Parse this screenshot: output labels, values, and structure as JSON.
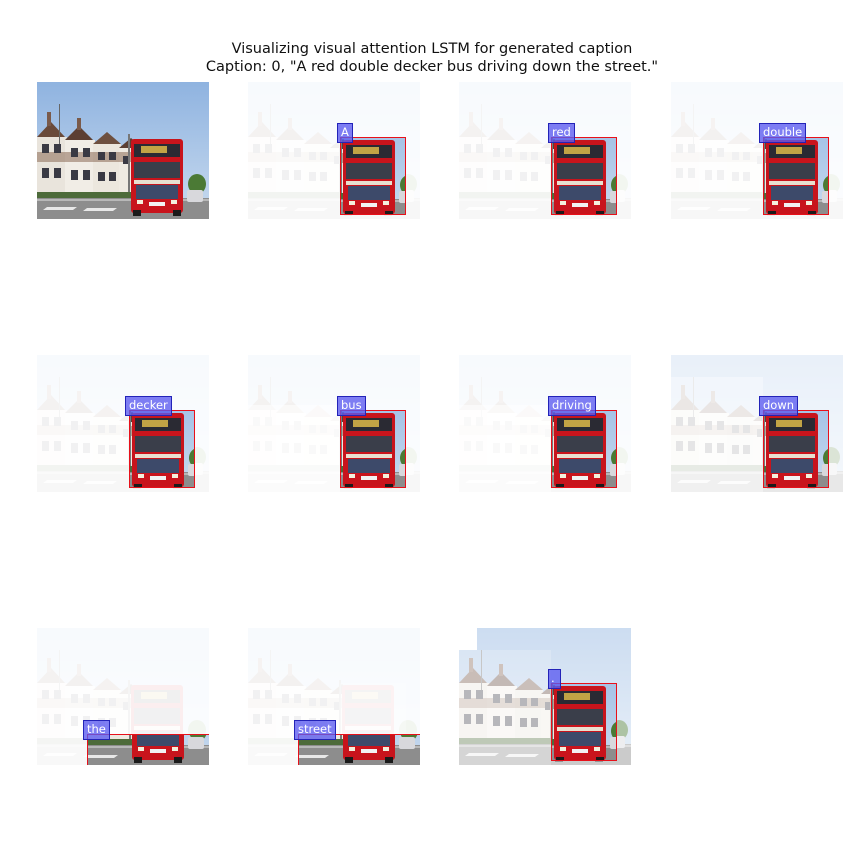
{
  "figure": {
    "title_line1": "Visualizing visual attention LSTM for generated caption",
    "title_line2": "Caption: 0, \"A red double decker bus driving down the street.\""
  },
  "original_image": {
    "label": "",
    "description_icon": "street-bus-photo"
  },
  "attention_panels": [
    {
      "word": "A"
    },
    {
      "word": "red"
    },
    {
      "word": "double"
    },
    {
      "word": "decker"
    },
    {
      "word": "bus"
    },
    {
      "word": "driving"
    },
    {
      "word": "down"
    },
    {
      "word": "the"
    },
    {
      "word": "street"
    },
    {
      "word": "."
    }
  ],
  "colors": {
    "highlight_box": "#e8101a",
    "word_label_bg": "#5a5af0",
    "bus_red": "#c8141c",
    "sky": "#a9c4e6"
  }
}
